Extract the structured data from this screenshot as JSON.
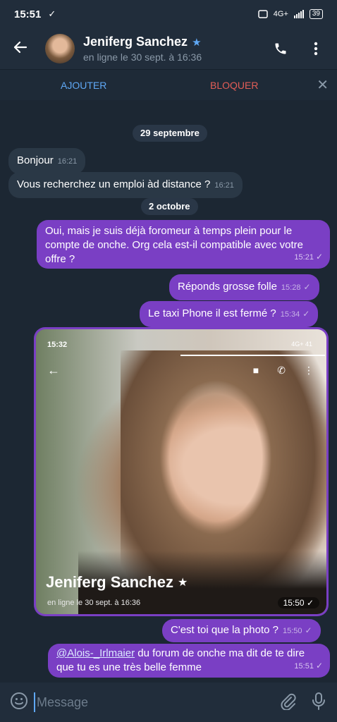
{
  "status_bar": {
    "time": "15:51",
    "download": "✓",
    "network": "4G+",
    "battery": "39"
  },
  "header": {
    "name": "Jeniferg Sanchez",
    "status": "en ligne le 30 sept. à 16:36"
  },
  "actions": {
    "add": "AJOUTER",
    "block": "BLOQUER",
    "close": "✕"
  },
  "chat": {
    "dates": [
      "29 septembre",
      "2 octobre"
    ],
    "messages": [
      {
        "text": "Bonjour",
        "time": "16:21"
      },
      {
        "text": "Vous recherchez un emploi àd distance ?",
        "time": "16:21"
      },
      {
        "text": "Oui, mais je suis déjà foromeur à temps plein pour le compte de onche. Org cela est-il compatible avec votre offre ?",
        "time": "15:21"
      },
      {
        "text": "Réponds grosse folle",
        "time": "15:28"
      },
      {
        "text": "Le taxi Phone il est fermé ?",
        "time": "15:34"
      },
      {
        "text": "C'est toi que la photo ?",
        "time": "15:50"
      },
      {
        "mention": "@Alois-_Irlmaier",
        "text": " du forum de onche ma dit de te dire que tu es une très belle femme",
        "time": "15:51"
      }
    ],
    "photo": {
      "status_time": "15:32",
      "status_right": "4G+ 41",
      "name": "Jeniferg Sanchez",
      "status_line": "en ligne le 30 sept. à 16:36",
      "time": "15:50"
    }
  },
  "input": {
    "placeholder": "Message"
  },
  "colors": {
    "accent": "#5fa8f5",
    "outgoing": "#7a3fc4",
    "danger": "#e25d57"
  }
}
